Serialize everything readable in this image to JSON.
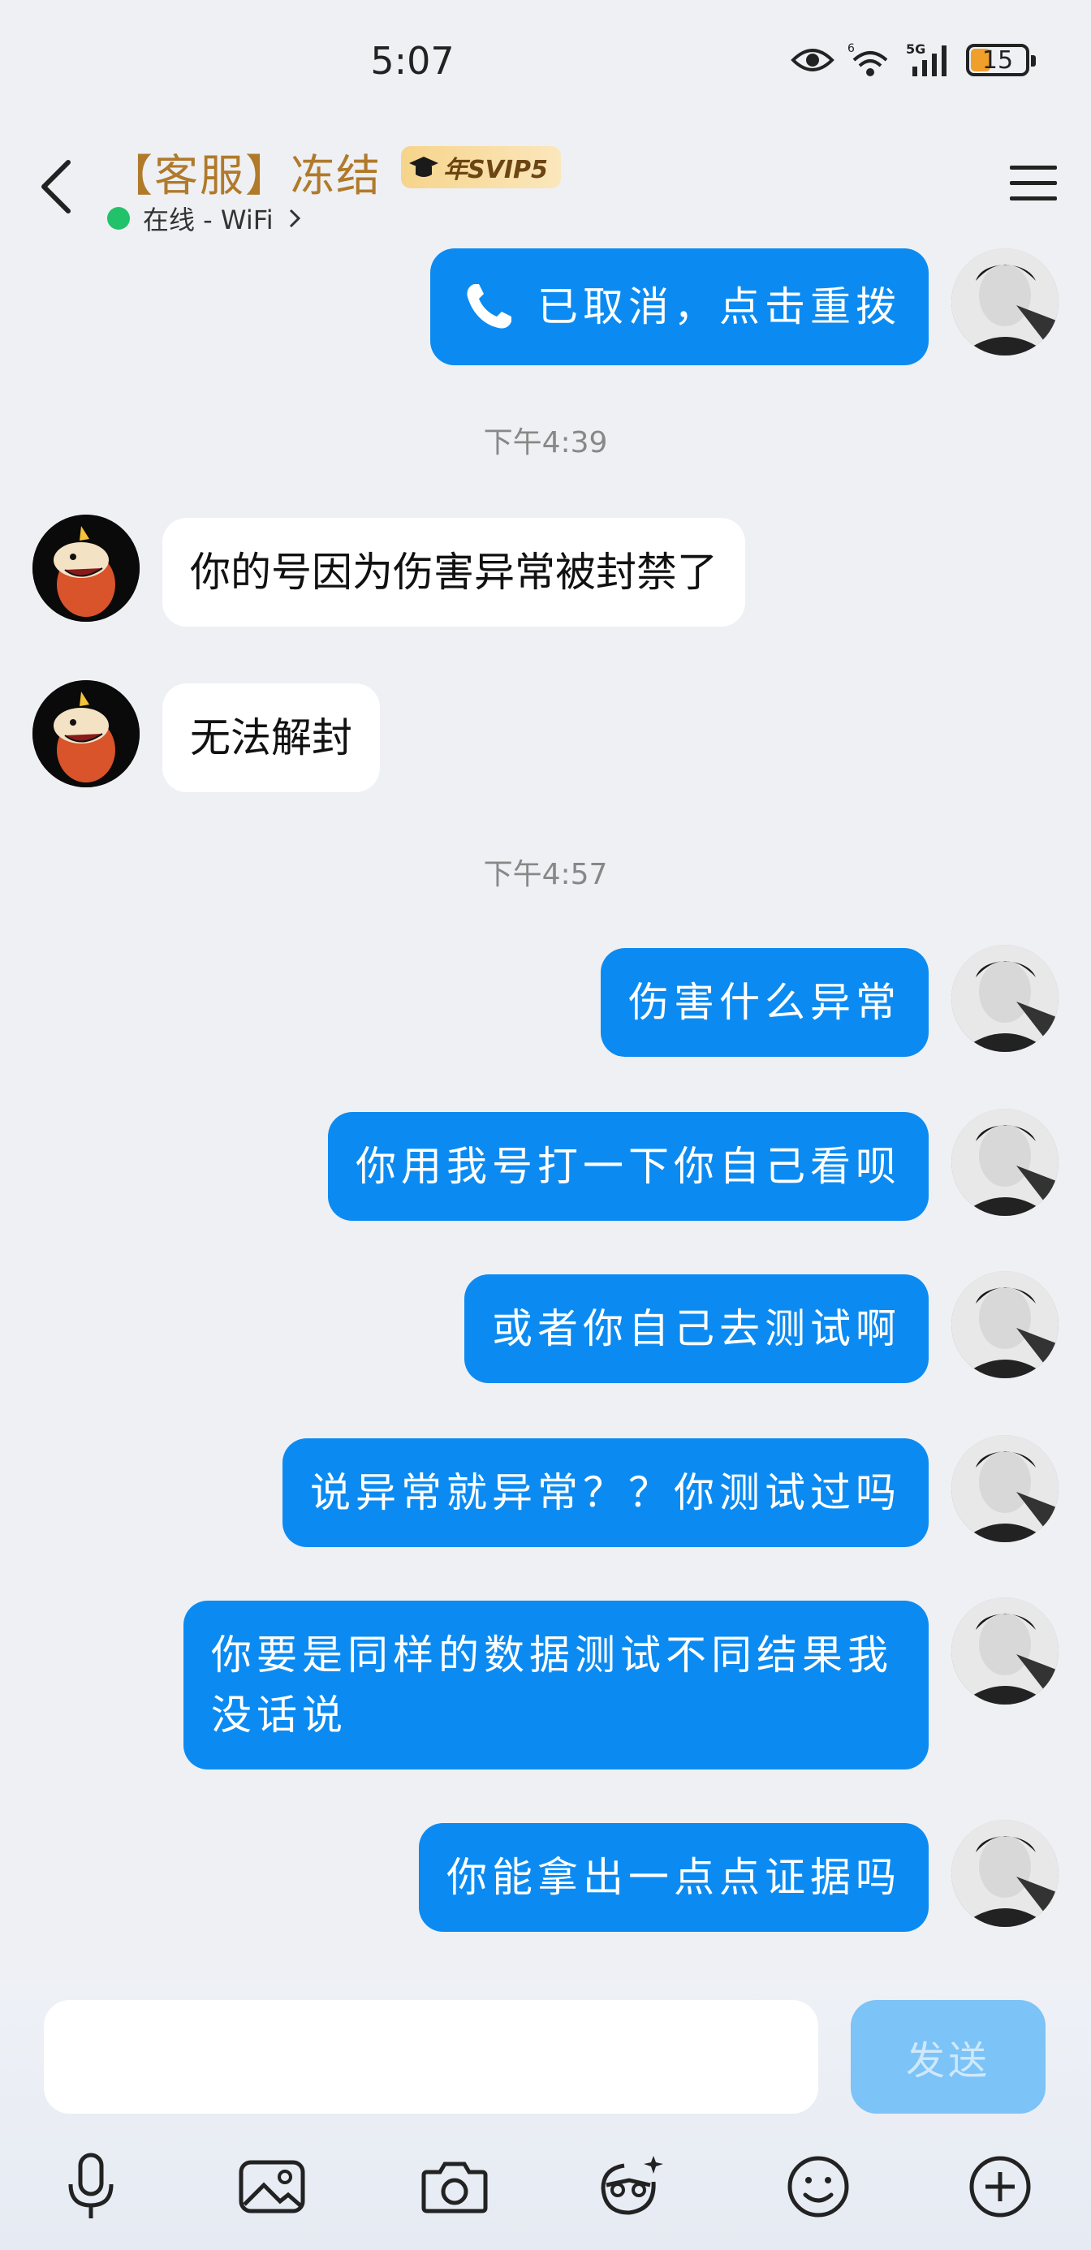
{
  "status_bar": {
    "time": "5:07",
    "battery": "15",
    "signal_label": "5G",
    "wifi_label": "6"
  },
  "header": {
    "contact_name": "【客服】冻结",
    "vip_badge": "年SVIP5",
    "status_text": "在线 - WiFi",
    "accent_color": "#b07a2a",
    "online_color": "#22c26a"
  },
  "messages": [
    {
      "sender": "self",
      "text": "已取消，点击重拨",
      "type": "call"
    },
    {
      "type": "timestamp",
      "text": "下午4:39"
    },
    {
      "sender": "other",
      "text": "你的号因为伤害异常被封禁了"
    },
    {
      "sender": "other",
      "text": "无法解封"
    },
    {
      "type": "timestamp",
      "text": "下午4:57"
    },
    {
      "sender": "self",
      "text": "伤害什么异常"
    },
    {
      "sender": "self",
      "text": "你用我号打一下你自己看呗"
    },
    {
      "sender": "self",
      "text": "或者你自己去测试啊"
    },
    {
      "sender": "self",
      "text": "说异常就异常？？你测试过吗"
    },
    {
      "sender": "self",
      "text": "你要是同样的数据测试不同结果我没话说"
    },
    {
      "sender": "self",
      "text": "你能拿出一点点证据吗"
    }
  ],
  "input": {
    "placeholder": "",
    "send_label": "发送"
  },
  "toolbar": {
    "icons": [
      "microphone-icon",
      "image-icon",
      "camera-icon",
      "sticker-face-icon",
      "emoji-icon",
      "plus-icon"
    ]
  },
  "colors": {
    "self_bubble": "#0b8bf2",
    "other_bubble": "#ffffff",
    "background": "#eef0f4"
  }
}
